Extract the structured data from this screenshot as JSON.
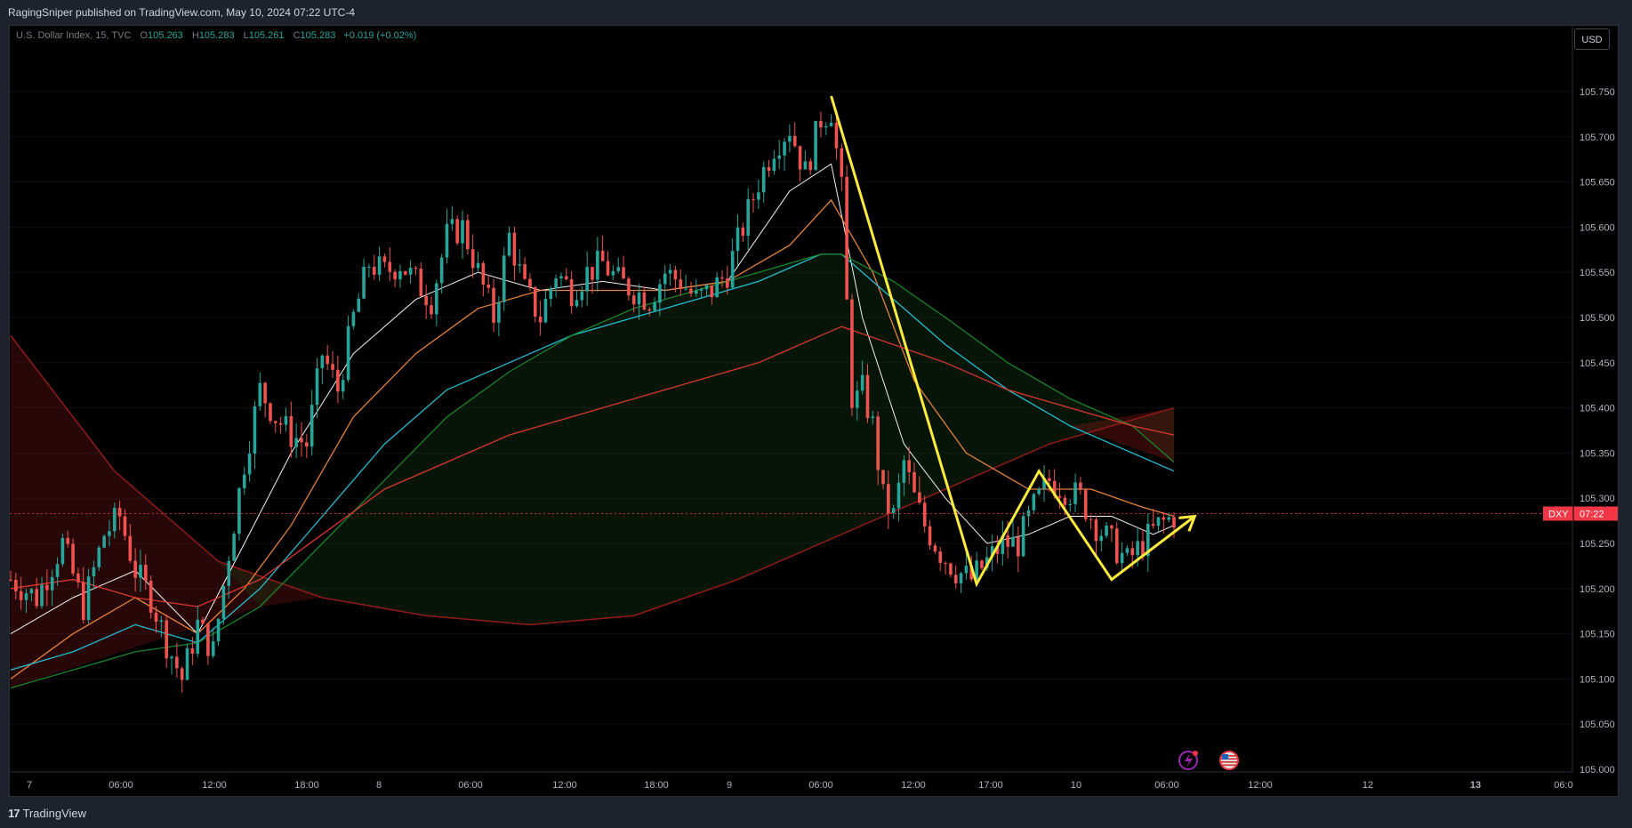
{
  "header": {
    "published_text": "RagingSniper published on TradingView.com, May 10, 2024 07:22 UTC-4"
  },
  "legend": {
    "symbol": "U.S. Dollar Index, 15, TVC",
    "open_label": "O",
    "open": "105.263",
    "high_label": "H",
    "high": "105.283",
    "low_label": "L",
    "low": "105.261",
    "close_label": "C",
    "close": "105.283",
    "change": "+0.019 (+0.02%)"
  },
  "currency_button": "USD",
  "footer": {
    "logo_mark": "17",
    "logo_text": "TradingView"
  },
  "colors": {
    "background": "#000000",
    "up": "#26a69a",
    "down": "#ef5350",
    "annotation": "#ffeb3b",
    "price_tag": "#f23645"
  },
  "chart_data": {
    "type": "candlestick",
    "symbol": "DXY",
    "timeframe": "15",
    "price_tag": {
      "label": "DXY",
      "time": "07:22",
      "value": 105.283
    },
    "y_axis": {
      "ticks": [
        "105.750",
        "105.700",
        "105.650",
        "105.600",
        "105.550",
        "105.500",
        "105.450",
        "105.400",
        "105.350",
        "105.300",
        "105.250",
        "105.200",
        "105.150",
        "105.100",
        "105.050",
        "105.000"
      ],
      "range": [
        104.975,
        105.825
      ]
    },
    "x_axis": {
      "ticks": [
        "7",
        "06:00",
        "12:00",
        "18:00",
        "8",
        "06:00",
        "12:00",
        "18:00",
        "9",
        "06:00",
        "12:00",
        "17:00",
        "10",
        "06:00",
        "12:00",
        "12",
        "13",
        "06:0"
      ],
      "bold": [
        "13"
      ]
    },
    "price_path": [
      {
        "i": 0,
        "v": 105.21
      },
      {
        "i": 5,
        "v": 105.19
      },
      {
        "i": 10,
        "v": 105.25
      },
      {
        "i": 14,
        "v": 105.18
      },
      {
        "i": 18,
        "v": 105.26
      },
      {
        "i": 21,
        "v": 105.28
      },
      {
        "i": 24,
        "v": 105.22
      },
      {
        "i": 27,
        "v": 105.19
      },
      {
        "i": 30,
        "v": 105.14
      },
      {
        "i": 33,
        "v": 105.1
      },
      {
        "i": 36,
        "v": 105.16
      },
      {
        "i": 39,
        "v": 105.13
      },
      {
        "i": 42,
        "v": 105.24
      },
      {
        "i": 45,
        "v": 105.34
      },
      {
        "i": 48,
        "v": 105.42
      },
      {
        "i": 51,
        "v": 105.39
      },
      {
        "i": 54,
        "v": 105.37
      },
      {
        "i": 57,
        "v": 105.36
      },
      {
        "i": 60,
        "v": 105.46
      },
      {
        "i": 63,
        "v": 105.42
      },
      {
        "i": 66,
        "v": 105.5
      },
      {
        "i": 69,
        "v": 105.56
      },
      {
        "i": 72,
        "v": 105.55
      },
      {
        "i": 75,
        "v": 105.56
      },
      {
        "i": 78,
        "v": 105.54
      },
      {
        "i": 81,
        "v": 105.52
      },
      {
        "i": 84,
        "v": 105.59
      },
      {
        "i": 87,
        "v": 105.6
      },
      {
        "i": 90,
        "v": 105.55
      },
      {
        "i": 93,
        "v": 105.5
      },
      {
        "i": 96,
        "v": 105.59
      },
      {
        "i": 99,
        "v": 105.53
      },
      {
        "i": 102,
        "v": 105.5
      },
      {
        "i": 105,
        "v": 105.55
      },
      {
        "i": 108,
        "v": 105.53
      },
      {
        "i": 111,
        "v": 105.55
      },
      {
        "i": 114,
        "v": 105.56
      },
      {
        "i": 117,
        "v": 105.54
      },
      {
        "i": 120,
        "v": 105.53
      },
      {
        "i": 123,
        "v": 105.52
      },
      {
        "i": 126,
        "v": 105.55
      },
      {
        "i": 129,
        "v": 105.54
      },
      {
        "i": 132,
        "v": 105.52
      },
      {
        "i": 135,
        "v": 105.53
      },
      {
        "i": 138,
        "v": 105.55
      },
      {
        "i": 141,
        "v": 105.6
      },
      {
        "i": 144,
        "v": 105.65
      },
      {
        "i": 147,
        "v": 105.69
      },
      {
        "i": 150,
        "v": 105.71
      },
      {
        "i": 153,
        "v": 105.66
      },
      {
        "i": 156,
        "v": 105.72
      },
      {
        "i": 158,
        "v": 105.73
      },
      {
        "i": 160,
        "v": 105.64
      },
      {
        "i": 162,
        "v": 105.4
      },
      {
        "i": 164,
        "v": 105.42
      },
      {
        "i": 166,
        "v": 105.38
      },
      {
        "i": 168,
        "v": 105.3
      },
      {
        "i": 170,
        "v": 105.28
      },
      {
        "i": 172,
        "v": 105.34
      },
      {
        "i": 174,
        "v": 105.3
      },
      {
        "i": 176,
        "v": 105.27
      },
      {
        "i": 179,
        "v": 105.24
      },
      {
        "i": 182,
        "v": 105.22
      },
      {
        "i": 185,
        "v": 105.21
      },
      {
        "i": 188,
        "v": 105.23
      },
      {
        "i": 191,
        "v": 105.25
      },
      {
        "i": 194,
        "v": 105.25
      },
      {
        "i": 197,
        "v": 105.29
      },
      {
        "i": 200,
        "v": 105.32
      },
      {
        "i": 203,
        "v": 105.31
      },
      {
        "i": 206,
        "v": 105.3
      },
      {
        "i": 209,
        "v": 105.27
      },
      {
        "i": 212,
        "v": 105.25
      },
      {
        "i": 215,
        "v": 105.23
      },
      {
        "i": 218,
        "v": 105.25
      },
      {
        "i": 221,
        "v": 105.27
      },
      {
        "i": 224,
        "v": 105.28
      }
    ],
    "moving_averages": [
      {
        "name": "MA1",
        "color": "#ffffff",
        "points": [
          [
            0,
            105.15
          ],
          [
            12,
            105.19
          ],
          [
            24,
            105.22
          ],
          [
            36,
            105.15
          ],
          [
            45,
            105.25
          ],
          [
            54,
            105.35
          ],
          [
            66,
            105.46
          ],
          [
            78,
            105.52
          ],
          [
            90,
            105.55
          ],
          [
            102,
            105.53
          ],
          [
            114,
            105.54
          ],
          [
            126,
            105.53
          ],
          [
            138,
            105.54
          ],
          [
            150,
            105.64
          ],
          [
            158,
            105.67
          ],
          [
            164,
            105.5
          ],
          [
            172,
            105.36
          ],
          [
            180,
            105.3
          ],
          [
            188,
            105.25
          ],
          [
            196,
            105.26
          ],
          [
            204,
            105.28
          ],
          [
            212,
            105.28
          ],
          [
            220,
            105.26
          ],
          [
            224,
            105.27
          ]
        ]
      },
      {
        "name": "MA2",
        "color": "#f0883e",
        "points": [
          [
            0,
            105.1
          ],
          [
            12,
            105.15
          ],
          [
            24,
            105.19
          ],
          [
            36,
            105.15
          ],
          [
            45,
            105.2
          ],
          [
            54,
            105.27
          ],
          [
            66,
            105.39
          ],
          [
            78,
            105.46
          ],
          [
            90,
            105.51
          ],
          [
            102,
            105.53
          ],
          [
            114,
            105.53
          ],
          [
            126,
            105.53
          ],
          [
            138,
            105.54
          ],
          [
            150,
            105.58
          ],
          [
            158,
            105.63
          ],
          [
            166,
            105.55
          ],
          [
            174,
            105.43
          ],
          [
            184,
            105.35
          ],
          [
            196,
            105.31
          ],
          [
            208,
            105.31
          ],
          [
            218,
            105.29
          ],
          [
            224,
            105.28
          ]
        ]
      },
      {
        "name": "MA3",
        "color": "#26c6da",
        "points": [
          [
            0,
            105.11
          ],
          [
            12,
            105.13
          ],
          [
            24,
            105.16
          ],
          [
            36,
            105.14
          ],
          [
            48,
            105.2
          ],
          [
            60,
            105.28
          ],
          [
            72,
            105.36
          ],
          [
            84,
            105.42
          ],
          [
            96,
            105.45
          ],
          [
            108,
            105.48
          ],
          [
            120,
            105.5
          ],
          [
            132,
            105.52
          ],
          [
            144,
            105.54
          ],
          [
            156,
            105.57
          ],
          [
            160,
            105.57
          ],
          [
            170,
            105.52
          ],
          [
            180,
            105.47
          ],
          [
            192,
            105.42
          ],
          [
            204,
            105.38
          ],
          [
            216,
            105.35
          ],
          [
            224,
            105.33
          ]
        ]
      },
      {
        "name": "MA4",
        "color": "#1b8a2e",
        "points": [
          [
            0,
            105.09
          ],
          [
            12,
            105.11
          ],
          [
            24,
            105.13
          ],
          [
            36,
            105.14
          ],
          [
            48,
            105.18
          ],
          [
            60,
            105.25
          ],
          [
            72,
            105.32
          ],
          [
            84,
            105.39
          ],
          [
            96,
            105.44
          ],
          [
            108,
            105.48
          ],
          [
            120,
            105.51
          ],
          [
            132,
            105.53
          ],
          [
            144,
            105.55
          ],
          [
            156,
            105.57
          ],
          [
            160,
            105.57
          ],
          [
            170,
            105.54
          ],
          [
            180,
            105.5
          ],
          [
            192,
            105.45
          ],
          [
            204,
            105.41
          ],
          [
            216,
            105.38
          ],
          [
            224,
            105.34
          ]
        ]
      },
      {
        "name": "MA5",
        "color": "#e53935",
        "points": [
          [
            0,
            105.2
          ],
          [
            12,
            105.21
          ],
          [
            24,
            105.19
          ],
          [
            36,
            105.18
          ],
          [
            48,
            105.21
          ],
          [
            60,
            105.26
          ],
          [
            72,
            105.31
          ],
          [
            84,
            105.34
          ],
          [
            96,
            105.37
          ],
          [
            108,
            105.39
          ],
          [
            120,
            105.41
          ],
          [
            132,
            105.43
          ],
          [
            144,
            105.45
          ],
          [
            156,
            105.48
          ],
          [
            160,
            105.49
          ],
          [
            170,
            105.47
          ],
          [
            180,
            105.45
          ],
          [
            192,
            105.42
          ],
          [
            204,
            105.4
          ],
          [
            216,
            105.38
          ],
          [
            224,
            105.37
          ]
        ]
      }
    ],
    "curve": {
      "name": "parabola",
      "color": "#8b1a1a",
      "points": [
        [
          0,
          105.48
        ],
        [
          20,
          105.33
        ],
        [
          40,
          105.23
        ],
        [
          60,
          105.19
        ],
        [
          80,
          105.17
        ],
        [
          100,
          105.16
        ],
        [
          120,
          105.17
        ],
        [
          140,
          105.21
        ],
        [
          160,
          105.26
        ],
        [
          180,
          105.31
        ],
        [
          200,
          105.36
        ],
        [
          224,
          105.4
        ]
      ]
    },
    "annotations": {
      "yellow_path": [
        [
          158,
          105.745
        ],
        [
          186,
          105.205
        ],
        [
          198,
          105.33
        ],
        [
          212,
          105.21
        ],
        [
          228,
          105.28
        ]
      ]
    }
  }
}
